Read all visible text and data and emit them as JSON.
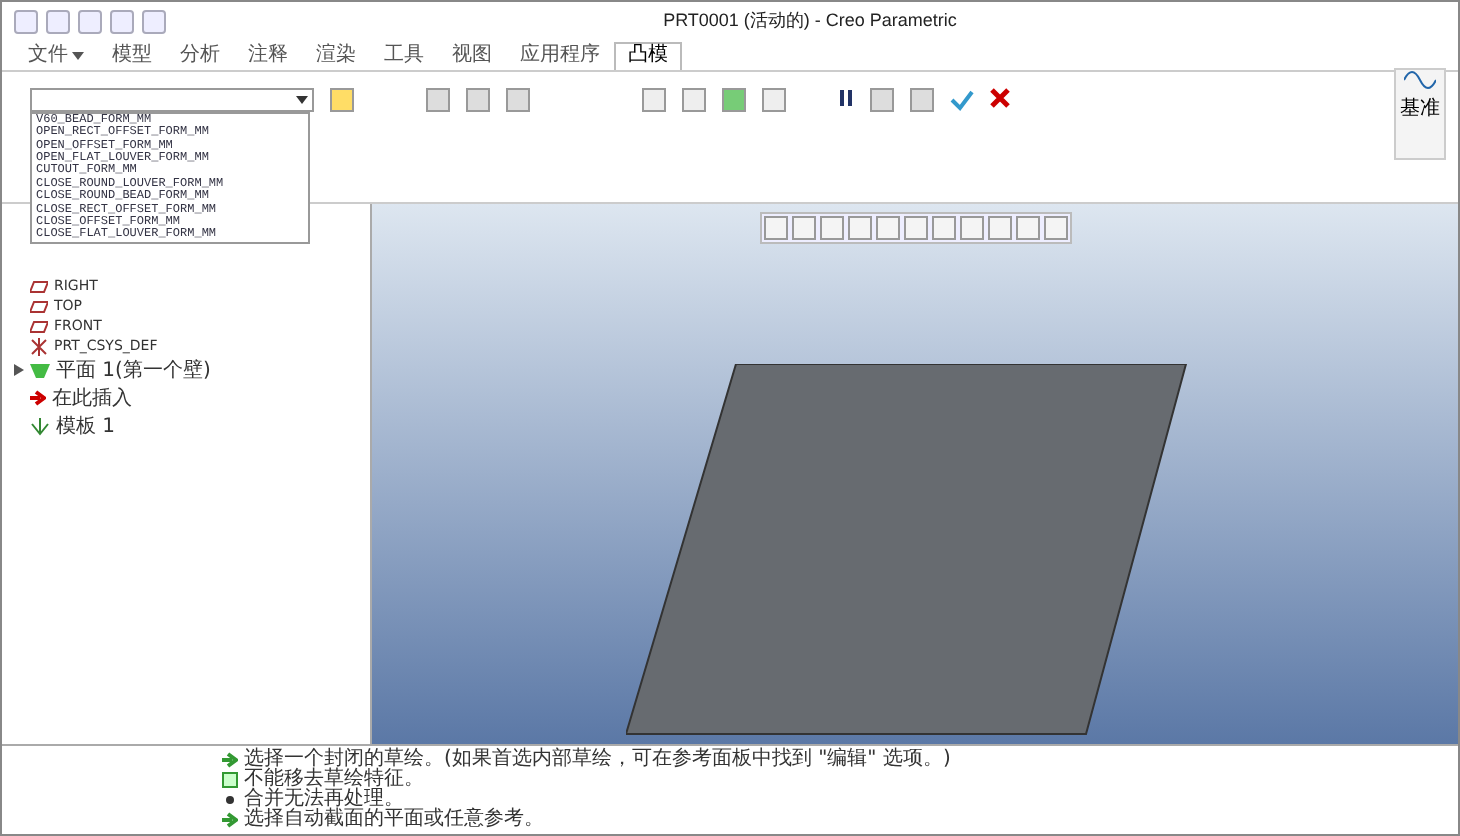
{
  "window": {
    "title": "PRT0001 (活动的) - Creo Parametric"
  },
  "tabs": [
    {
      "label": "文件",
      "selected": false,
      "menu": true
    },
    {
      "label": "模型",
      "selected": false
    },
    {
      "label": "分析",
      "selected": false
    },
    {
      "label": "注释",
      "selected": false
    },
    {
      "label": "渲染",
      "selected": false
    },
    {
      "label": "工具",
      "selected": false
    },
    {
      "label": "视图",
      "selected": false
    },
    {
      "label": "应用程序",
      "selected": false
    },
    {
      "label": "凸模",
      "selected": true
    }
  ],
  "form_dropdown": {
    "options": [
      "V60_BEAD_FORM_MM",
      "OPEN_RECT_OFFSET_FORM_MM",
      "OPEN_OFFSET_FORM_MM",
      "OPEN_FLAT_LOUVER_FORM_MM",
      "CUTOUT_FORM_MM",
      "CLOSE_ROUND_LOUVER_FORM_MM",
      "CLOSE_ROUND_BEAD_FORM_MM",
      "CLOSE_RECT_OFFSET_FORM_MM",
      "CLOSE_OFFSET_FORM_MM",
      "CLOSE_FLAT_LOUVER_FORM_MM"
    ]
  },
  "datum_button": {
    "label": "基准"
  },
  "model_tree": [
    {
      "label": "RIGHT",
      "kind": "plane"
    },
    {
      "label": "TOP",
      "kind": "plane"
    },
    {
      "label": "FRONT",
      "kind": "plane"
    },
    {
      "label": "PRT_CSYS_DEF",
      "kind": "csys"
    },
    {
      "label": "平面 1(第一个壁)",
      "kind": "wall",
      "expanded": false
    },
    {
      "label": "在此插入",
      "kind": "insert"
    },
    {
      "label": "模板 1",
      "kind": "punch"
    }
  ],
  "status_messages": [
    {
      "text": "选择一个封闭的草绘。(如果首选内部草绘，可在参考面板中找到 \"编辑\" 选项。)",
      "kind": "prompt"
    },
    {
      "text": "不能移去草绘特征。",
      "kind": "info"
    },
    {
      "text": "合并无法再处理。",
      "kind": "bullet"
    },
    {
      "text": "选择自动截面的平面或任意参考。",
      "kind": "prompt"
    }
  ]
}
